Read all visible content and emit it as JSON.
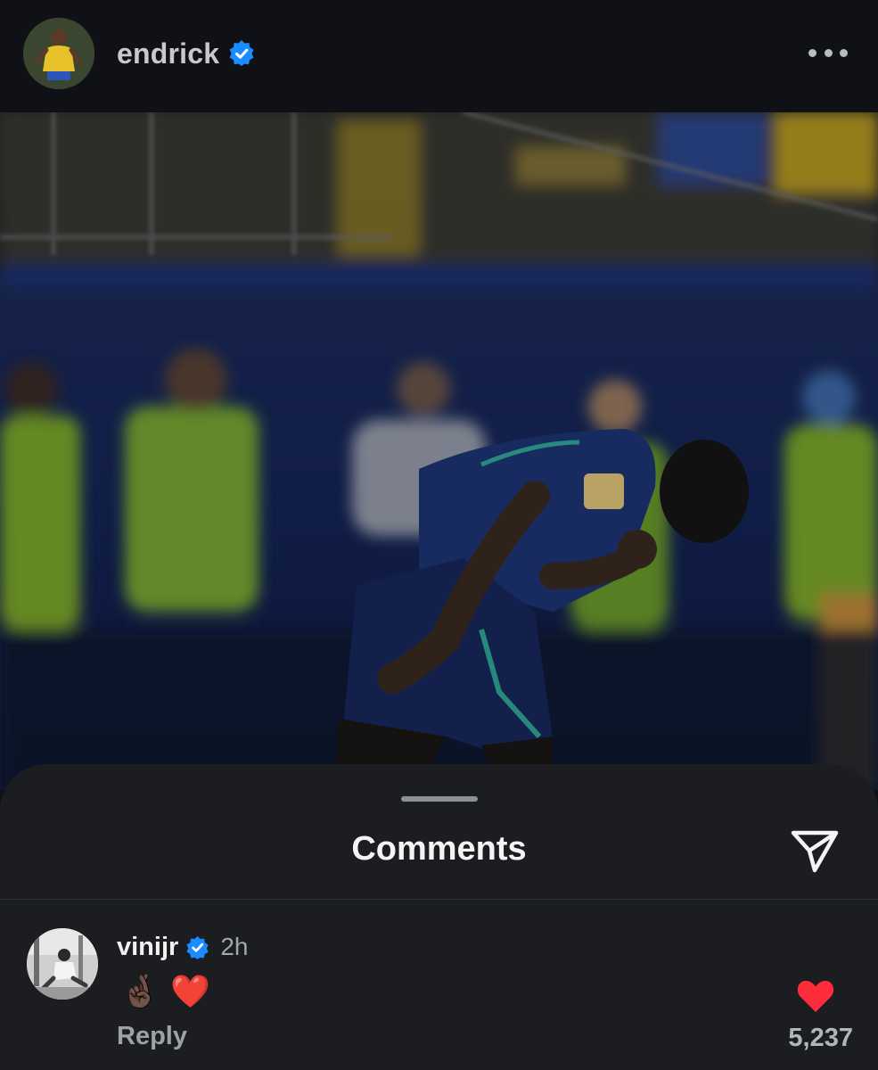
{
  "post": {
    "username": "endrick",
    "avatar_icon": "player-avatar",
    "verified_icon": "verified-badge-icon",
    "more_icon": "more-options-icon"
  },
  "photo": {
    "icon": "post-photo-football-player"
  },
  "comments_sheet": {
    "title": "Comments",
    "share_icon": "send-icon",
    "comment": {
      "username": "vinijr",
      "time": "2h",
      "text": "🤞🏿 ❤️",
      "reply_label": "Reply",
      "likes": "5,237",
      "like_icon": "heart-icon"
    }
  },
  "colors": {
    "background": "#0f1116",
    "sheet": "#1b1d21",
    "verified": "#1a8cff",
    "heart": "#ff2d3c"
  }
}
